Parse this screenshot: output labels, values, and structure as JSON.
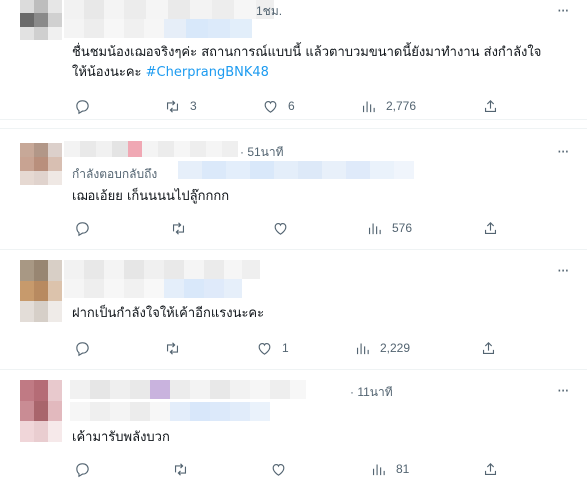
{
  "tweets": [
    {
      "time": "1ชม.",
      "text_main": "ชื่นชมน้องเฌอจริงๆค่ะ สถานการณ์แบบนี้ แล้วตาบวมขนาดนี้ยังมาทำงาน ส่งกำลังใจ",
      "text_line2": "ให้น้องนะคะ ",
      "hashtag": "#CherprangBNK48",
      "replies": "",
      "retweets": "3",
      "likes": "6",
      "views": "2,776"
    },
    {
      "time": "51นาที",
      "replying_to": "กำลังตอบกลับถึง",
      "text_main": "เฌอเอ้ยย เก็นนนนไปลู๊กกกก",
      "replies": "",
      "retweets": "",
      "likes": "",
      "views": "576"
    },
    {
      "time": "",
      "text_main": "ฝากเป็นกำลังใจให้เค้าอีกแรงนะคะ",
      "replies": "",
      "retweets": "",
      "likes": "1",
      "views": "2,229"
    },
    {
      "time": "11นาที",
      "text_main": "เค้ามารับพลังบวก",
      "replies": "",
      "retweets": "",
      "likes": "",
      "views": "81"
    }
  ],
  "icons": {
    "more": "more-icon",
    "reply": "reply-icon",
    "retweet": "retweet-icon",
    "like": "heart-icon",
    "views": "views-icon",
    "share": "share-icon"
  },
  "colors": {
    "link": "#1d9bf0",
    "muted": "#536471",
    "text": "#0f1419"
  }
}
